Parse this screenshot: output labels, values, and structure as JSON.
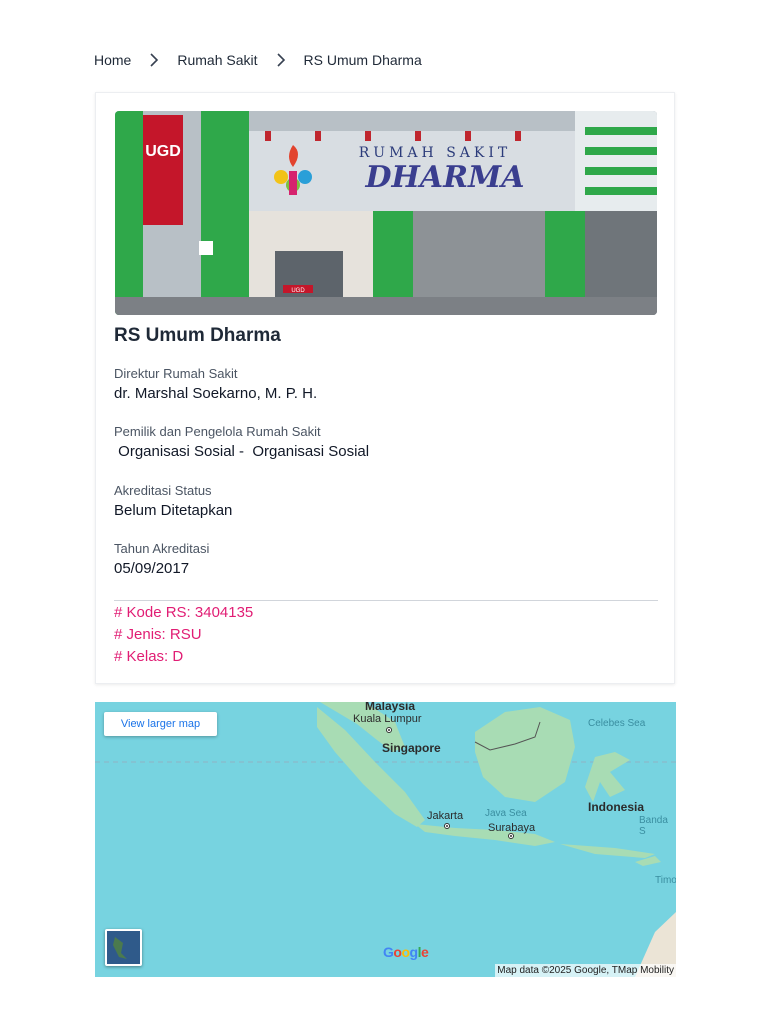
{
  "breadcrumb": {
    "home": "Home",
    "category": "Rumah Sakit",
    "current": "RS Umum Dharma"
  },
  "hospital": {
    "photo_signage": {
      "line1": "RUMAH SAKIT",
      "line2": "DHARMA",
      "ugd": "UGD",
      "door_sign": "UGD"
    },
    "name": "RS Umum Dharma",
    "fields": [
      {
        "label": "Direktur Rumah Sakit",
        "value": "dr. Marshal Soekarno, M. P. H."
      },
      {
        "label": "Pemilik dan Pengelola Rumah Sakit",
        "value": " Organisasi Sosial -  Organisasi Sosial"
      },
      {
        "label": "Akreditasi Status",
        "value": "Belum Ditetapkan"
      },
      {
        "label": "Tahun Akreditasi",
        "value": "05/09/2017"
      }
    ],
    "tags": [
      "# Kode RS: 3404135",
      "# Jenis: RSU",
      "# Kelas: D"
    ]
  },
  "map": {
    "view_larger": "View larger map",
    "labels": {
      "malaysia": "Malaysia",
      "kuala_lumpur": "Kuala Lumpur",
      "singapore": "Singapore",
      "celebes_sea": "Celebes Sea",
      "indonesia": "Indonesia",
      "java_sea": "Java Sea",
      "jakarta": "Jakarta",
      "surabaya": "Surabaya",
      "banda_sea": "Banda S",
      "timor": "Timo"
    },
    "logo": "Google",
    "attribution": "Map data ©2025 Google, TMap Mobility"
  },
  "colors": {
    "tag": "#e11d74",
    "link": "#1a73e8",
    "sea": "#77d3e0",
    "land": "#a8dcb4"
  },
  "icons": {
    "separator": "chevron-right-icon",
    "map_type": "satellite-layer-icon"
  }
}
